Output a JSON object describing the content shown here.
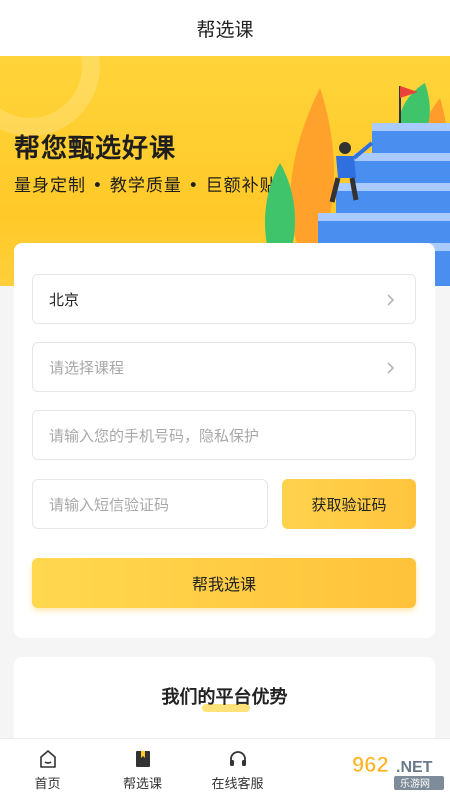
{
  "header": {
    "title": "帮选课"
  },
  "hero": {
    "title": "帮您甄选好课",
    "subtitle": "量身定制 • 教学质量 • 巨额补贴"
  },
  "form": {
    "city_value": "北京",
    "course_placeholder": "请选择课程",
    "phone_placeholder": "请输入您的手机号码，隐私保护",
    "code_placeholder": "请输入短信验证码",
    "get_code_label": "获取验证码",
    "submit_label": "帮我选课"
  },
  "advantages": {
    "title": "我们的平台优势"
  },
  "tabbar": {
    "items": [
      {
        "label": "首页",
        "icon": "home-icon"
      },
      {
        "label": "帮选课",
        "icon": "bookmark-book-icon"
      },
      {
        "label": "在线客服",
        "icon": "headset-icon"
      }
    ]
  },
  "watermark": {
    "text": "962.NET",
    "sub": "乐游网"
  },
  "colors": {
    "accent": "#ffc928",
    "button": "#ffc43d",
    "text": "#222222",
    "placeholder": "#a8a8a8"
  }
}
